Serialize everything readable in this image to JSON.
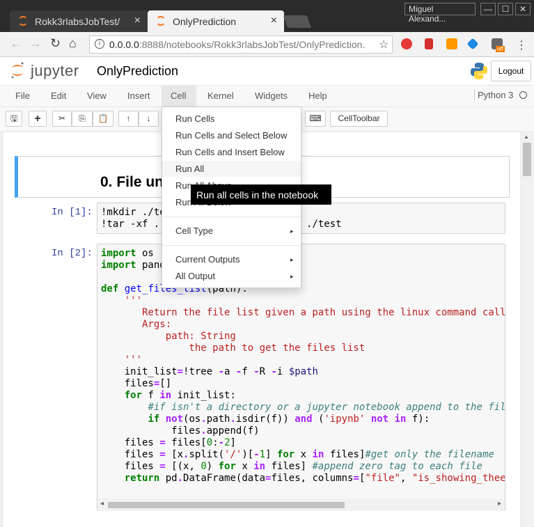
{
  "browser": {
    "tabs": [
      {
        "label": "Rokk3rlabsJobTest/",
        "close": "×"
      },
      {
        "label": "OnlyPrediction",
        "close": "×"
      }
    ],
    "profile_name": "Miguel Alexand...",
    "window_controls": [
      "—",
      "☐",
      "✕"
    ],
    "url_host": "0.0.0.0",
    "url_rest": ":8888/notebooks/Rokk3rlabsJobTest/OnlyPrediction.",
    "nav": {
      "back": "←",
      "forward": "→",
      "reload": "↻",
      "home": "⌂",
      "star": "☆",
      "menu": "⋮"
    },
    "ext_badge": "off"
  },
  "jupyter": {
    "logo_text": "jupyter",
    "notebook_title": "OnlyPrediction",
    "logout_label": "Logout",
    "menus": [
      "File",
      "Edit",
      "View",
      "Insert",
      "Cell",
      "Kernel",
      "Widgets",
      "Help"
    ],
    "kernel_name": "Python 3",
    "toolbar": {
      "save": "🖫",
      "add": "+",
      "cut": "✂",
      "copy": "⎘",
      "paste": "📋",
      "up": "↑",
      "down": "↓",
      "keyboard": "⌨",
      "celltoolbar": "CellToolbar"
    }
  },
  "cell_menu": {
    "items": [
      "Run Cells",
      "Run Cells and Select Below",
      "Run Cells and Insert Below",
      "Run All",
      "Run All Above",
      "Run All Below"
    ],
    "cell_type": "Cell Type",
    "current_outputs": "Current Outputs",
    "all_output": "All Output",
    "tooltip": "Run all cells in the notebook",
    "arrow": "▸"
  },
  "notebook": {
    "markdown_heading": "0. File un",
    "cell1": {
      "prompt": "In [1]:",
      "line1": "!mkdir ./te",
      "line2a": "!tar -xf .",
      "line2b": "./test"
    },
    "cell2": {
      "prompt": "In [2]:"
    }
  },
  "scroll_arrows": {
    "left": "◂",
    "right": "▸",
    "up": "▲"
  }
}
